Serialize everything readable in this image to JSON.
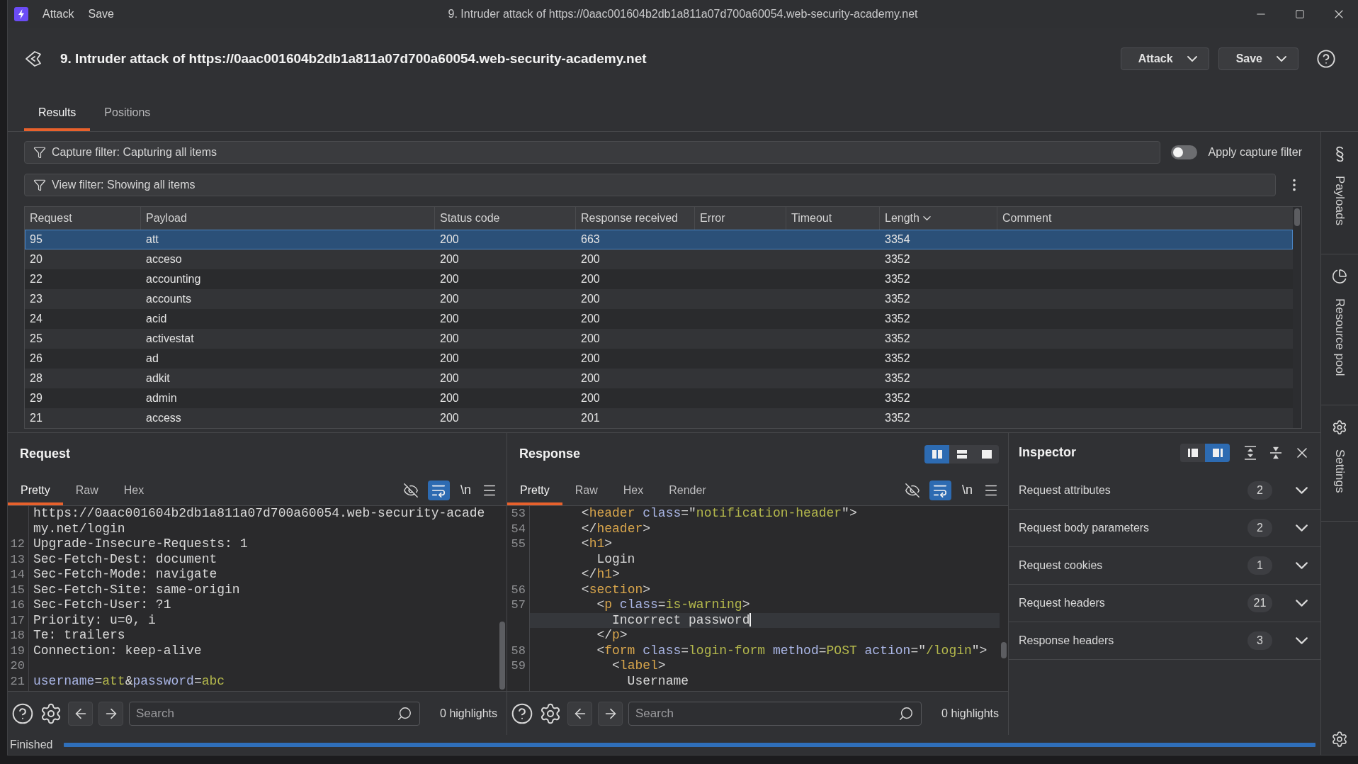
{
  "window": {
    "menu": [
      "Attack",
      "Save"
    ],
    "title": "9. Intruder attack of https://0aac001604b2db1a811a07d700a60054.web-security-academy.net"
  },
  "header": {
    "title": "9. Intruder attack of https://0aac001604b2db1a811a07d700a60054.web-security-academy.net",
    "buttons": [
      "Attack",
      "Save"
    ]
  },
  "tabs": [
    {
      "label": "Results",
      "selected": true
    },
    {
      "label": "Positions",
      "selected": false
    }
  ],
  "capture_filter": {
    "text": "Capture filter: Capturing all items",
    "toggle_label": "Apply capture filter",
    "on": false
  },
  "view_filter": {
    "text": "View filter: Showing all items"
  },
  "table": {
    "columns": [
      {
        "label": "Request",
        "sorted": false
      },
      {
        "label": "Payload",
        "sorted": false
      },
      {
        "label": "Status code",
        "sorted": false
      },
      {
        "label": "Response received",
        "sorted": false
      },
      {
        "label": "Error",
        "sorted": false
      },
      {
        "label": "Timeout",
        "sorted": false
      },
      {
        "label": "Length",
        "sorted": true
      },
      {
        "label": "Comment",
        "sorted": false
      }
    ],
    "rows": [
      {
        "request": "95",
        "payload": "att",
        "status_code": "200",
        "response_received": "663",
        "length": "3354",
        "selected": true
      },
      {
        "request": "20",
        "payload": "acceso",
        "status_code": "200",
        "response_received": "200",
        "length": "3352",
        "selected": false
      },
      {
        "request": "22",
        "payload": "accounting",
        "status_code": "200",
        "response_received": "200",
        "length": "3352",
        "selected": false
      },
      {
        "request": "23",
        "payload": "accounts",
        "status_code": "200",
        "response_received": "200",
        "length": "3352",
        "selected": false
      },
      {
        "request": "24",
        "payload": "acid",
        "status_code": "200",
        "response_received": "200",
        "length": "3352",
        "selected": false
      },
      {
        "request": "25",
        "payload": "activestat",
        "status_code": "200",
        "response_received": "200",
        "length": "3352",
        "selected": false
      },
      {
        "request": "26",
        "payload": "ad",
        "status_code": "200",
        "response_received": "200",
        "length": "3352",
        "selected": false
      },
      {
        "request": "28",
        "payload": "adkit",
        "status_code": "200",
        "response_received": "200",
        "length": "3352",
        "selected": false
      },
      {
        "request": "29",
        "payload": "admin",
        "status_code": "200",
        "response_received": "200",
        "length": "3352",
        "selected": false
      },
      {
        "request": "21",
        "payload": "access",
        "status_code": "200",
        "response_received": "201",
        "length": "3352",
        "selected": false
      }
    ]
  },
  "request": {
    "title": "Request",
    "tabs": [
      {
        "label": "Pretty",
        "selected": true
      },
      {
        "label": "Raw",
        "selected": false
      },
      {
        "label": "Hex",
        "selected": false
      }
    ],
    "word_wrap": true,
    "newline_label": "\\n",
    "lines": [
      {
        "caret": false,
        "tokens": [
          {
            "kind": "plain",
            "text": "https://0aac001604b2db1a811a07d700a60054.web-security-acade"
          }
        ]
      },
      {
        "caret": false,
        "tokens": [
          {
            "kind": "plain",
            "text": "my.net/login"
          }
        ]
      },
      {
        "number": "12",
        "caret": false,
        "tokens": [
          {
            "kind": "plain",
            "text": "Upgrade-Insecure-Requests: 1"
          }
        ]
      },
      {
        "number": "13",
        "caret": false,
        "tokens": [
          {
            "kind": "plain",
            "text": "Sec-Fetch-Dest: document"
          }
        ]
      },
      {
        "number": "14",
        "caret": false,
        "tokens": [
          {
            "kind": "plain",
            "text": "Sec-Fetch-Mode: navigate"
          }
        ]
      },
      {
        "number": "15",
        "caret": false,
        "tokens": [
          {
            "kind": "plain",
            "text": "Sec-Fetch-Site: same-origin"
          }
        ]
      },
      {
        "number": "16",
        "caret": false,
        "tokens": [
          {
            "kind": "plain",
            "text": "Sec-Fetch-User: ?1"
          }
        ]
      },
      {
        "number": "17",
        "caret": false,
        "tokens": [
          {
            "kind": "plain",
            "text": "Priority: u=0, i"
          }
        ]
      },
      {
        "number": "18",
        "caret": false,
        "tokens": [
          {
            "kind": "plain",
            "text": "Te: trailers"
          }
        ]
      },
      {
        "number": "19",
        "caret": false,
        "tokens": [
          {
            "kind": "plain",
            "text": "Connection: keep-alive"
          }
        ]
      },
      {
        "number": "20",
        "caret": false
      },
      {
        "number": "21",
        "caret": false,
        "tokens": [
          {
            "kind": "name",
            "text": "username"
          },
          {
            "kind": "punct",
            "text": "="
          },
          {
            "kind": "value",
            "text": "att"
          },
          {
            "kind": "punct",
            "text": "&"
          },
          {
            "kind": "name",
            "text": "password"
          },
          {
            "kind": "punct",
            "text": "="
          },
          {
            "kind": "value",
            "text": "abc"
          }
        ]
      }
    ],
    "search": {
      "placeholder": "Search"
    },
    "highlights": "0 highlights"
  },
  "response": {
    "title": "Response",
    "layout": [
      {
        "kind": "columns",
        "selected": true
      },
      {
        "kind": "rows",
        "selected": false
      },
      {
        "kind": "single",
        "selected": false
      }
    ],
    "tabs": [
      {
        "label": "Pretty",
        "selected": true
      },
      {
        "label": "Raw",
        "selected": false
      },
      {
        "label": "Hex",
        "selected": false
      },
      {
        "label": "Render",
        "selected": false
      }
    ],
    "word_wrap": true,
    "newline_label": "\\n",
    "lines": [
      {
        "number": "53",
        "caret": false,
        "tokens": [
          {
            "kind": "punct",
            "text": "      <"
          },
          {
            "kind": "tag",
            "text": "header"
          },
          {
            "kind": "name",
            "text": " class"
          },
          {
            "kind": "punct",
            "text": "=\""
          },
          {
            "kind": "value",
            "text": "notification-header"
          },
          {
            "kind": "punct",
            "text": "\">"
          }
        ]
      },
      {
        "number": "54",
        "caret": false,
        "tokens": [
          {
            "kind": "punct",
            "text": "      </"
          },
          {
            "kind": "tag",
            "text": "header"
          },
          {
            "kind": "punct",
            "text": ">"
          }
        ]
      },
      {
        "number": "55",
        "caret": false,
        "tokens": [
          {
            "kind": "punct",
            "text": "      <"
          },
          {
            "kind": "tag",
            "text": "h1"
          },
          {
            "kind": "punct",
            "text": ">"
          }
        ]
      },
      {
        "caret": false,
        "tokens": [
          {
            "kind": "plain",
            "text": "        Login"
          }
        ]
      },
      {
        "caret": false,
        "tokens": [
          {
            "kind": "punct",
            "text": "      </"
          },
          {
            "kind": "tag",
            "text": "h1"
          },
          {
            "kind": "punct",
            "text": ">"
          }
        ]
      },
      {
        "number": "56",
        "caret": false,
        "tokens": [
          {
            "kind": "punct",
            "text": "      <"
          },
          {
            "kind": "tag",
            "text": "section"
          },
          {
            "kind": "punct",
            "text": ">"
          }
        ]
      },
      {
        "number": "57",
        "caret": false,
        "tokens": [
          {
            "kind": "punct",
            "text": "        <"
          },
          {
            "kind": "tag",
            "text": "p"
          },
          {
            "kind": "name",
            "text": " class"
          },
          {
            "kind": "punct",
            "text": "="
          },
          {
            "kind": "value",
            "text": "is-warning"
          },
          {
            "kind": "punct",
            "text": ">"
          }
        ]
      },
      {
        "caret": true,
        "tokens": [
          {
            "kind": "plain",
            "text": "          Incorrect password"
          }
        ]
      },
      {
        "caret": false,
        "tokens": [
          {
            "kind": "punct",
            "text": "        </"
          },
          {
            "kind": "tag",
            "text": "p"
          },
          {
            "kind": "punct",
            "text": ">"
          }
        ]
      },
      {
        "number": "58",
        "caret": false,
        "tokens": [
          {
            "kind": "punct",
            "text": "        <"
          },
          {
            "kind": "tag",
            "text": "form"
          },
          {
            "kind": "name",
            "text": " class"
          },
          {
            "kind": "punct",
            "text": "="
          },
          {
            "kind": "value",
            "text": "login-form"
          },
          {
            "kind": "name",
            "text": " method"
          },
          {
            "kind": "punct",
            "text": "="
          },
          {
            "kind": "value",
            "text": "POST"
          },
          {
            "kind": "name",
            "text": " action"
          },
          {
            "kind": "punct",
            "text": "=\""
          },
          {
            "kind": "value",
            "text": "/login"
          },
          {
            "kind": "punct",
            "text": "\">"
          }
        ]
      },
      {
        "number": "59",
        "caret": false,
        "tokens": [
          {
            "kind": "punct",
            "text": "          <"
          },
          {
            "kind": "tag",
            "text": "label"
          },
          {
            "kind": "punct",
            "text": ">"
          }
        ]
      },
      {
        "caret": false,
        "tokens": [
          {
            "kind": "plain",
            "text": "            Username"
          }
        ]
      }
    ],
    "search": {
      "placeholder": "Search"
    },
    "highlights": "0 highlights"
  },
  "inspector": {
    "title": "Inspector",
    "layout": [
      {
        "kind": "left",
        "selected": false
      },
      {
        "kind": "right",
        "selected": true
      }
    ],
    "sections": [
      {
        "label": "Request attributes",
        "count": "2",
        "expanded": false
      },
      {
        "label": "Request body parameters",
        "count": "2",
        "expanded": false
      },
      {
        "label": "Request cookies",
        "count": "1",
        "expanded": false
      },
      {
        "label": "Request headers",
        "count": "21",
        "expanded": false
      },
      {
        "label": "Response headers",
        "count": "3",
        "expanded": false
      }
    ]
  },
  "side_panel": {
    "tabs": [
      {
        "kind": "payloads",
        "label": "Payloads"
      },
      {
        "kind": "pool",
        "label": "Resource pool"
      },
      {
        "kind": "settings",
        "label": "Settings"
      }
    ]
  },
  "status_bar": {
    "text": "Finished",
    "level": 1
  }
}
